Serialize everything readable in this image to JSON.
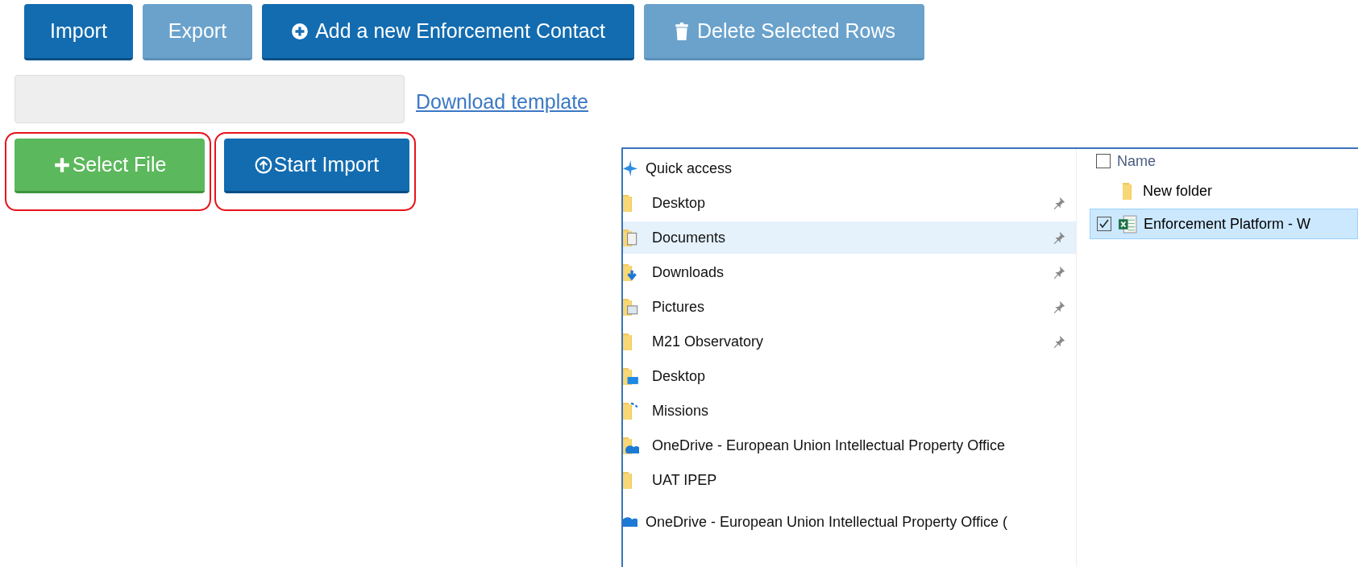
{
  "toolbar": [
    {
      "label": "Import",
      "disabled": false
    },
    {
      "label": "Export",
      "disabled": true
    },
    {
      "label": "Add a new Enforcement Contact",
      "disabled": false
    },
    {
      "label": "Delete Selected Rows",
      "disabled": true
    }
  ],
  "download_link": "Download template",
  "upload_buttons": [
    {
      "label": "Select File",
      "kind": "success",
      "highlighted": true
    },
    {
      "label": "Start Import",
      "kind": "primary",
      "highlighted": true
    }
  ],
  "file_dialog": {
    "nav_items": [
      {
        "label": "Quick access",
        "kind": "star",
        "pinned": false,
        "selected": false
      },
      {
        "label": "Desktop",
        "kind": "folder",
        "pinned": true,
        "selected": false
      },
      {
        "label": "Documents",
        "kind": "documents",
        "pinned": true,
        "selected": true
      },
      {
        "label": "Downloads",
        "kind": "downloads",
        "pinned": true,
        "selected": false
      },
      {
        "label": "Pictures",
        "kind": "pictures",
        "pinned": true,
        "selected": false
      },
      {
        "label": "M21 Observatory",
        "kind": "folder",
        "pinned": true,
        "selected": false
      },
      {
        "label": "Desktop",
        "kind": "desktop",
        "pinned": false,
        "selected": false
      },
      {
        "label": "Missions",
        "kind": "missions",
        "pinned": false,
        "selected": false
      },
      {
        "label": "OneDrive - European Union Intellectual Property Office",
        "kind": "onedrive",
        "pinned": false,
        "selected": false
      },
      {
        "label": "UAT IPEP",
        "kind": "folder",
        "pinned": false,
        "selected": false
      },
      {
        "label": "OneDrive - European Union Intellectual Property Office (",
        "kind": "cloud",
        "pinned": false,
        "selected": false
      }
    ],
    "name_header": {
      "label": "Name",
      "checked": false
    },
    "files": [
      {
        "name": "New folder",
        "kind": "folder",
        "selected": false,
        "checked": false
      },
      {
        "name": "Enforcement Platform - W",
        "kind": "spreadsheet",
        "selected": true,
        "checked": true
      }
    ]
  }
}
